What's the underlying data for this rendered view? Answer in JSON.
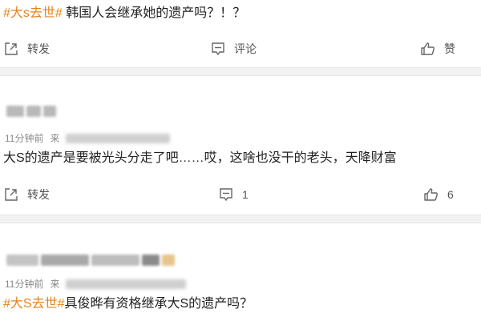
{
  "post": {
    "hashtag": "#大s去世#",
    "text": " 韩国人会继承她的遗产吗？！？",
    "actions": {
      "repost_label": "转发",
      "comment_label": "评论",
      "like_label": "赞"
    }
  },
  "comments": [
    {
      "time": "11分钟前",
      "source_prefix": "来",
      "text": "大S的遗产是要被光头分走了吧……哎，这啥也没干的老头，天降财富",
      "actions": {
        "repost_label": "转发",
        "comment_count": "1",
        "like_count": "6"
      }
    },
    {
      "time": "11分钟前",
      "source_prefix": "来",
      "hashtag": "#大S去世#",
      "text": "具俊晔有资格继承大S的遗产吗？"
    }
  ],
  "colors": {
    "hashtag": "#e8831a",
    "text": "#222222",
    "muted": "#888888",
    "divider": "#f2f2f2"
  }
}
